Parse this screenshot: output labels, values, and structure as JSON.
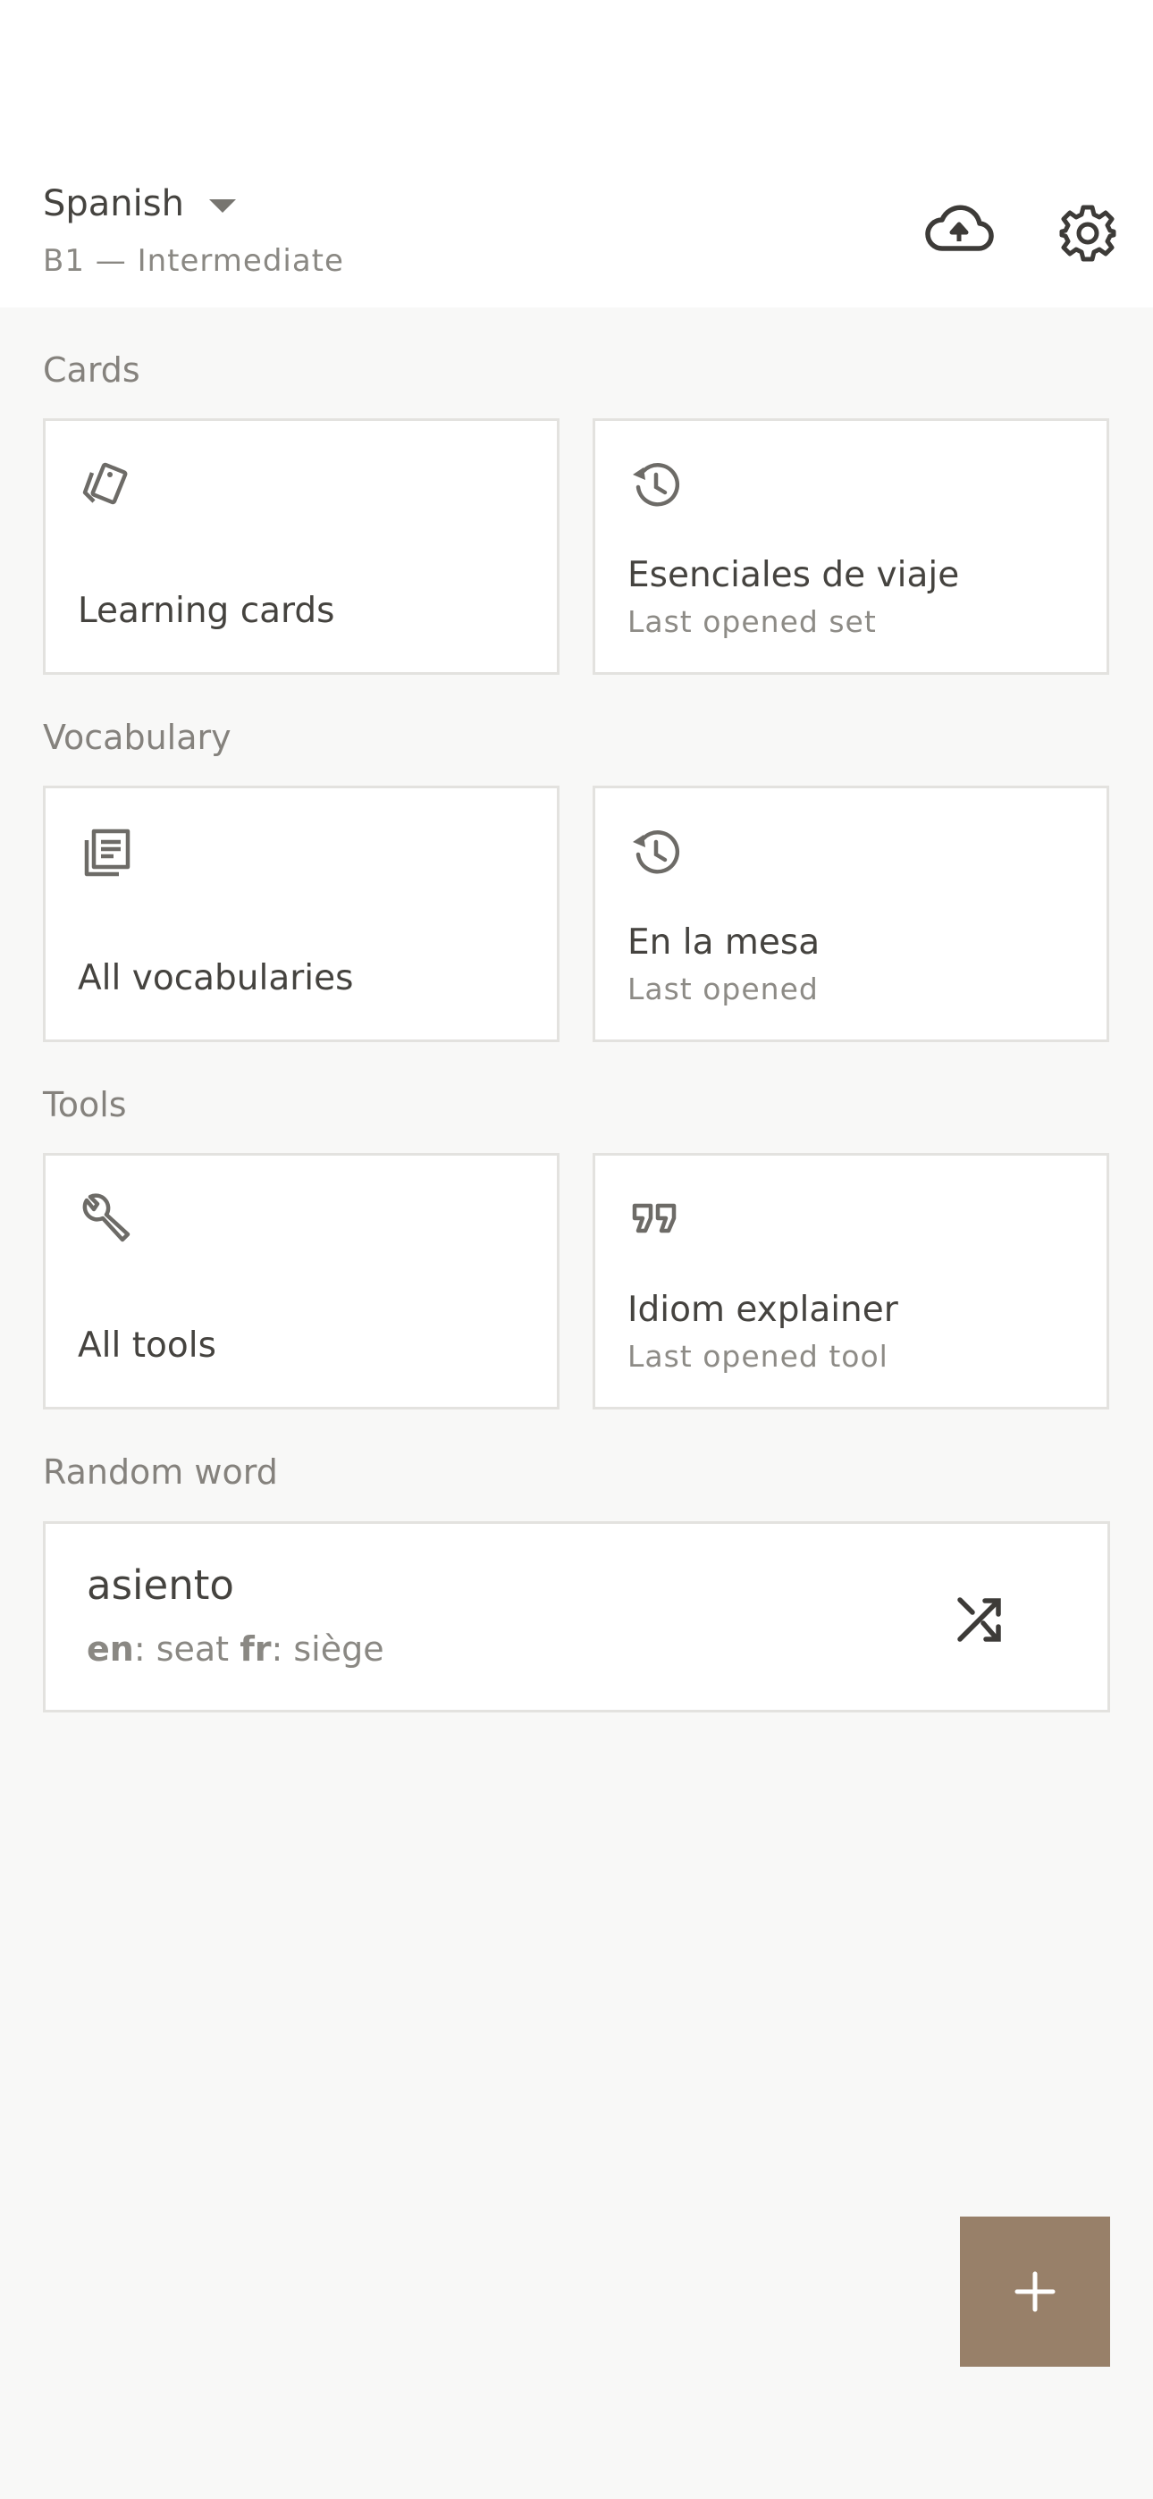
{
  "header": {
    "language": "Spanish",
    "level": "B1 — Intermediate",
    "icons": {
      "sync": "cloud-upload-icon",
      "settings": "gear-icon"
    }
  },
  "sections": {
    "cards": {
      "title": "Cards",
      "left": {
        "icon": "cards-icon",
        "title": "Learning cards"
      },
      "right": {
        "icon": "history-icon",
        "title": "Esenciales de viaje",
        "subtitle": "Last opened set"
      }
    },
    "vocabulary": {
      "title": "Vocabulary",
      "left": {
        "icon": "library-icon",
        "title": "All vocabularies"
      },
      "right": {
        "icon": "history-icon",
        "title": "En la mesa",
        "subtitle": "Last opened"
      }
    },
    "tools": {
      "title": "Tools",
      "left": {
        "icon": "wrench-icon",
        "title": "All tools"
      },
      "right": {
        "icon": "quote-icon",
        "title": "Idiom explainer",
        "subtitle": "Last opened tool"
      }
    }
  },
  "random_word": {
    "title": "Random word",
    "word": "asiento",
    "translations": [
      {
        "lang": "en",
        "text": "seat"
      },
      {
        "lang": "fr",
        "text": "siège"
      }
    ],
    "separator": ": ",
    "icon": "shuffle-icon"
  },
  "fab": {
    "icon": "plus-icon"
  },
  "colors": {
    "background": "#f8f8f7",
    "card": "#ffffff",
    "border": "#e3e2df",
    "accent": "#988069",
    "text": "#45433f",
    "muted": "#8a8883"
  }
}
